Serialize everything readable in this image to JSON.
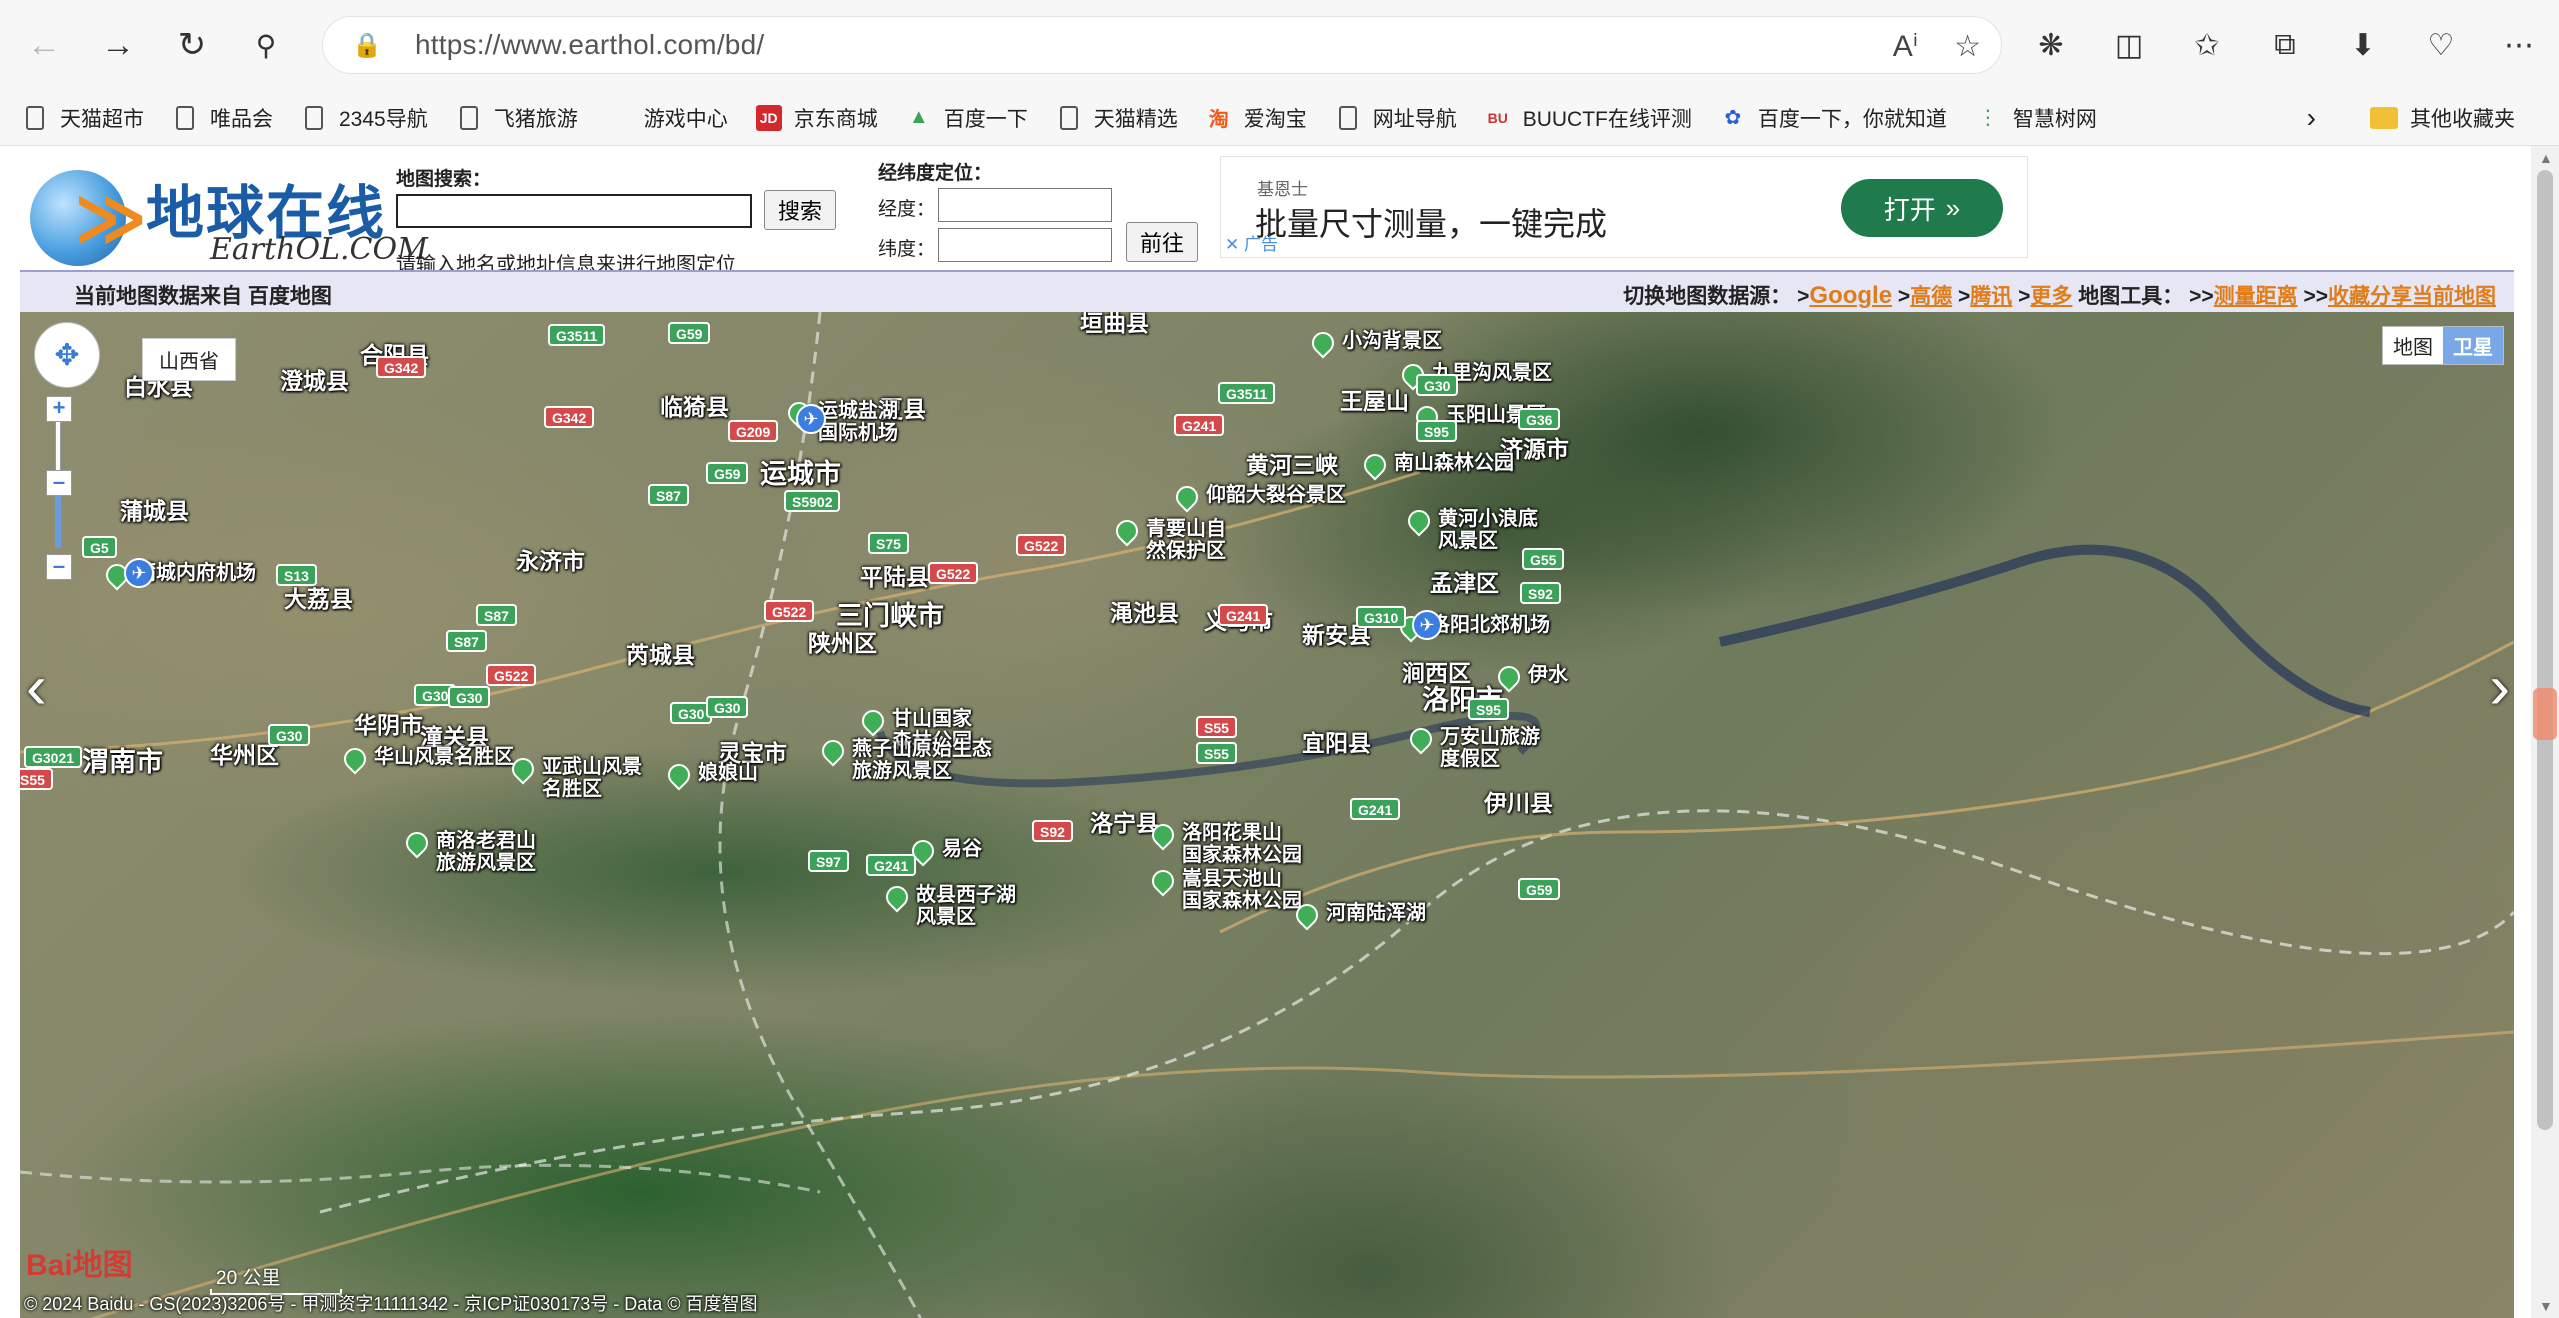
{
  "browser": {
    "url": "https://www.earthol.com/bd/",
    "bookmarks": [
      "天猫超市",
      "唯品会",
      "2345导航",
      "飞猪旅游",
      "游戏中心",
      "京东商城",
      "百度一下",
      "天猫精选",
      "爱淘宝",
      "网址导航",
      "BUUCTF在线评测",
      "百度一下，你就知道",
      "智慧树网"
    ],
    "other_bookmarks": "其他收藏夹"
  },
  "header": {
    "logo_cn": "地球在线",
    "logo_en": "EarthOL.COM",
    "search_label": "地图搜索：",
    "search_button": "搜索",
    "search_hint": "请输入地名或地址信息来进行地图定位",
    "coord_title": "经纬度定位：",
    "lng_label": "经度：",
    "lat_label": "纬度：",
    "go_button": "前往"
  },
  "ad": {
    "brand": "基恩士",
    "slogan": "批量尺寸测量，一键完成",
    "open": "打开",
    "tag": "广告"
  },
  "infobar": {
    "source": "当前地图数据来自 百度地图",
    "switch_label": "切换地图数据源：",
    "sources": [
      "Google",
      "高德",
      "腾讯",
      "更多"
    ],
    "tools_label": "地图工具：",
    "tools": [
      "测量距离",
      "收藏分享当前地图"
    ]
  },
  "map": {
    "province": "山西省",
    "type_map": "地图",
    "type_satellite": "卫星",
    "scale": "20 公里",
    "copyright": "© 2024 Baidu - GS(2023)3206号 - 甲测资字11111342 - 京ICP证030173号 - Data © 百度智图",
    "logo": "Bai地图",
    "places": [
      {
        "name": "合阳县",
        "cls": ""
      },
      {
        "name": "澄城县",
        "cls": ""
      },
      {
        "name": "白水县",
        "cls": ""
      },
      {
        "name": "临猗县",
        "cls": ""
      },
      {
        "name": "夏县",
        "cls": ""
      },
      {
        "name": "运城市",
        "cls": "city"
      },
      {
        "name": "蒲城县",
        "cls": ""
      },
      {
        "name": "永济市",
        "cls": ""
      },
      {
        "name": "大荔县",
        "cls": ""
      },
      {
        "name": "平陆县",
        "cls": ""
      },
      {
        "name": "三门峡市",
        "cls": "city"
      },
      {
        "name": "陕州区",
        "cls": ""
      },
      {
        "name": "芮城县",
        "cls": ""
      },
      {
        "name": "渑池县",
        "cls": ""
      },
      {
        "name": "义马市",
        "cls": ""
      },
      {
        "name": "新安县",
        "cls": ""
      },
      {
        "name": "孟津区",
        "cls": ""
      },
      {
        "name": "涧西区",
        "cls": ""
      },
      {
        "name": "洛阳市",
        "cls": "city"
      },
      {
        "name": "华阴市",
        "cls": ""
      },
      {
        "name": "潼关县",
        "cls": ""
      },
      {
        "name": "渭南市",
        "cls": "city"
      },
      {
        "name": "华州区",
        "cls": ""
      },
      {
        "name": "灵宝市",
        "cls": ""
      },
      {
        "name": "宜阳县",
        "cls": ""
      },
      {
        "name": "伊川县",
        "cls": ""
      },
      {
        "name": "洛宁县",
        "cls": ""
      },
      {
        "name": "王屋山",
        "cls": ""
      },
      {
        "name": "济源市",
        "cls": ""
      },
      {
        "name": "黄河三峡",
        "cls": ""
      },
      {
        "name": "小沟背景区",
        "cls": "poi"
      },
      {
        "name": "九里沟风景区",
        "cls": "poi"
      },
      {
        "name": "玉阳山景区",
        "cls": "poi"
      },
      {
        "name": "南山森林公园",
        "cls": "poi"
      },
      {
        "name": "仰韶大裂谷景区",
        "cls": "poi"
      },
      {
        "name": "青要山自\n然保护区",
        "cls": "poi"
      },
      {
        "name": "黄河小浪底\n风景区",
        "cls": "poi"
      },
      {
        "name": "洛阳北郊机场",
        "cls": "poi"
      },
      {
        "name": "伊水",
        "cls": "poi"
      },
      {
        "name": "万安山旅游\n度假区",
        "cls": "poi"
      },
      {
        "name": "甘山国家\n森林公园",
        "cls": "poi"
      },
      {
        "name": "燕子山原始生态\n旅游风景区",
        "cls": "poi"
      },
      {
        "name": "华山风景名胜区",
        "cls": "poi"
      },
      {
        "name": "亚武山风景\n名胜区",
        "cls": "poi"
      },
      {
        "name": "娘娘山",
        "cls": "poi"
      },
      {
        "name": "商洛老君山\n旅游风景区",
        "cls": "poi"
      },
      {
        "name": "易谷",
        "cls": "poi"
      },
      {
        "name": "洛阳花果山\n国家森林公园",
        "cls": "poi"
      },
      {
        "name": "嵩县天池山\n国家森林公园",
        "cls": "poi"
      },
      {
        "name": "故县西子湖\n风景区",
        "cls": "poi"
      },
      {
        "name": "河南陆浑湖",
        "cls": "poi"
      },
      {
        "name": "运城盐湖\n国际机场",
        "cls": "poi"
      },
      {
        "name": "蒲城内府机场",
        "cls": "poi"
      },
      {
        "name": "垣曲县",
        "cls": ""
      }
    ],
    "roads": [
      "G3511",
      "G59",
      "G342",
      "G342",
      "G209",
      "G59",
      "S87",
      "S5902",
      "G5",
      "S13",
      "S75",
      "G522",
      "G522",
      "G522",
      "S87",
      "S87",
      "G522",
      "G30",
      "G30",
      "G30",
      "G30",
      "G30",
      "G3021",
      "G3511",
      "G241",
      "G241",
      "G310",
      "G30",
      "S95",
      "S95",
      "G55",
      "S55",
      "S55",
      "G241",
      "S92",
      "S97",
      "G241",
      "G59",
      "S92",
      "G36",
      "S55"
    ]
  }
}
